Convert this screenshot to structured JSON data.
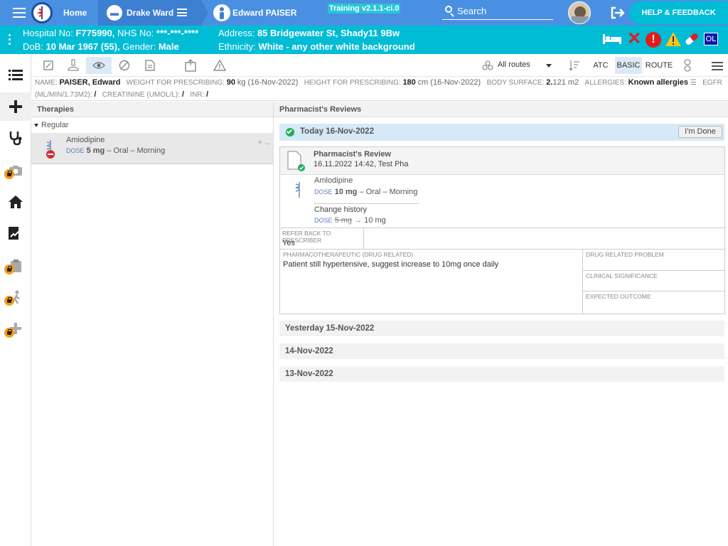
{
  "topbar": {
    "home": "Home",
    "ward": "Drake Ward",
    "patient": "Edward PAISER",
    "training": "Training v2.1.1-ci.0",
    "search": "Search",
    "help": "HELP & FEEDBACK"
  },
  "patient_bar": {
    "hospital_label": "Hospital No:",
    "hospital": "F775990,",
    "nhs_label": "NHS No:",
    "nhs": "***-***-****",
    "dob_label": "DoB:",
    "dob": "10 Mar 1967 (55),",
    "gender_label": "Gender:",
    "gender": "Male",
    "address_label": "Address:",
    "address": "85 Bridgewater St, Shady11 9Bw",
    "ethnicity_label": "Ethnicity:",
    "ethnicity": "White - any other white background",
    "ol": "OL"
  },
  "toolbar": {
    "routes": "All routes",
    "atc": "ATC",
    "basic": "BASIC",
    "route": "ROUTE"
  },
  "info": {
    "name_label": "NAME:",
    "name": "PAISER, Edward",
    "weight_label": "WEIGHT FOR PRESCRIBING:",
    "weight": "90",
    "weight_unit": "kg (16-Nov-2022)",
    "height_label": "HEIGHT FOR PRESCRIBING:",
    "height": "180",
    "height_unit": "cm (16-Nov-2022)",
    "bs_label": "BODY SURFACE:",
    "bs": "2.",
    "bs_rest": "121 m2",
    "allergies_label": "ALLERGIES:",
    "allergies": "Known allergies",
    "egfr_label": "EGFR",
    "unit_label": "(ML/MIN/1.73M2):",
    "unit_value": "/",
    "creat_label": "CREATININE (UMOL/L):",
    "creat_value": "/",
    "inr_label": "INR:",
    "inr_value": "/"
  },
  "therapies": {
    "title": "Therapies",
    "group": "Regular",
    "drug": "Amiodipine",
    "dose_label": "DOSE",
    "dose": "5 mg",
    "route": "– Oral – Morning"
  },
  "reviews": {
    "title": "Pharmacist's Reviews",
    "today": "Today 16-Nov-2022",
    "done": "I'm Done",
    "review_title": "Pharmacist's Review",
    "review_meta": "16.11.2022 14:42, Test Pha",
    "drug": "Amlodipine",
    "dose_label": "DOSE",
    "dose": "10 mg",
    "route": "– Oral – Morning",
    "change_history": "Change history",
    "old_dose": "5 mg",
    "new_dose": "10 mg",
    "refer_label": "REFER BACK TO PRESCRIBER",
    "refer_value": "Yes",
    "pharma_label": "PHARMACOTHERAPEUTIC (DRUG RELATED)",
    "pharma_value": "Patient still hypertensive, suggest increase to 10mg once daily",
    "drp_label": "DRUG RELATED PROBLEM",
    "clin_label": "CLINICAL SIGNIFICANCE",
    "outcome_label": "EXPECTED OUTCOME",
    "days": [
      "Yesterday 15-Nov-2022",
      "14-Nov-2022",
      "13-Nov-2022"
    ]
  },
  "colors": {
    "topbar": "#4a90e2",
    "patient_bar": "#00bcd4",
    "accent": "#5b7cbf"
  }
}
